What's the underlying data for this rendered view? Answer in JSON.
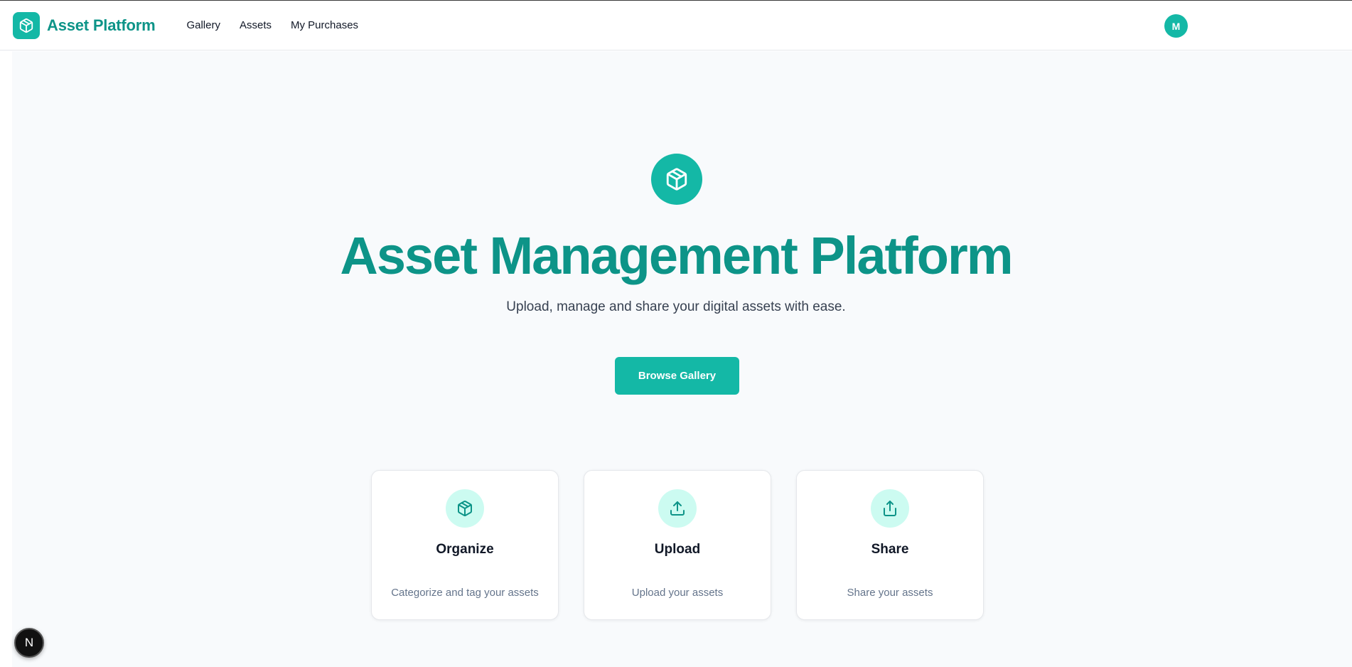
{
  "header": {
    "brand": "Asset Platform",
    "nav": [
      "Gallery",
      "Assets",
      "My Purchases"
    ],
    "avatar_initial": "M"
  },
  "hero": {
    "title": "Asset Management Platform",
    "subtitle": "Upload, manage and share your digital assets with ease.",
    "cta_label": "Browse Gallery"
  },
  "features": [
    {
      "title": "Organize",
      "description": "Categorize and tag your assets",
      "icon": "package-icon"
    },
    {
      "title": "Upload",
      "description": "Upload your assets",
      "icon": "upload-icon"
    },
    {
      "title": "Share",
      "description": "Share your assets",
      "icon": "share-icon"
    }
  ],
  "dev_badge": "N",
  "colors": {
    "accent": "#14b8a6",
    "accent_dark": "#0d9488",
    "accent_light": "#ccfbf1",
    "background": "#f8fafc"
  }
}
